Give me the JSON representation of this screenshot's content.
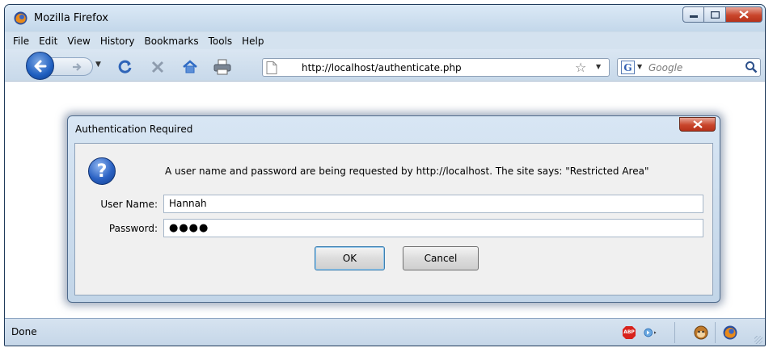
{
  "window": {
    "title": "Mozilla Firefox"
  },
  "menubar": {
    "items": [
      "File",
      "Edit",
      "View",
      "History",
      "Bookmarks",
      "Tools",
      "Help"
    ]
  },
  "navbar": {
    "url": "http://localhost/authenticate.php",
    "search_placeholder": "Google",
    "icons": [
      "back-icon",
      "forward-icon",
      "reload-icon",
      "stop-icon",
      "home-icon",
      "print-icon"
    ]
  },
  "dialog": {
    "title": "Authentication Required",
    "message": "A user name and password are being requested by http://localhost. The site says: \"Restricted Area\"",
    "username_label": "User Name:",
    "username_value": "Hannah",
    "password_label": "Password:",
    "password_value": "●●●●",
    "ok_label": "OK",
    "cancel_label": "Cancel"
  },
  "statusbar": {
    "text": "Done",
    "abp_label": "ABP"
  },
  "colors": {
    "titlebar": "#c3d7ea",
    "close_button": "#c9462c",
    "dialog_body": "#f0f0f0"
  }
}
